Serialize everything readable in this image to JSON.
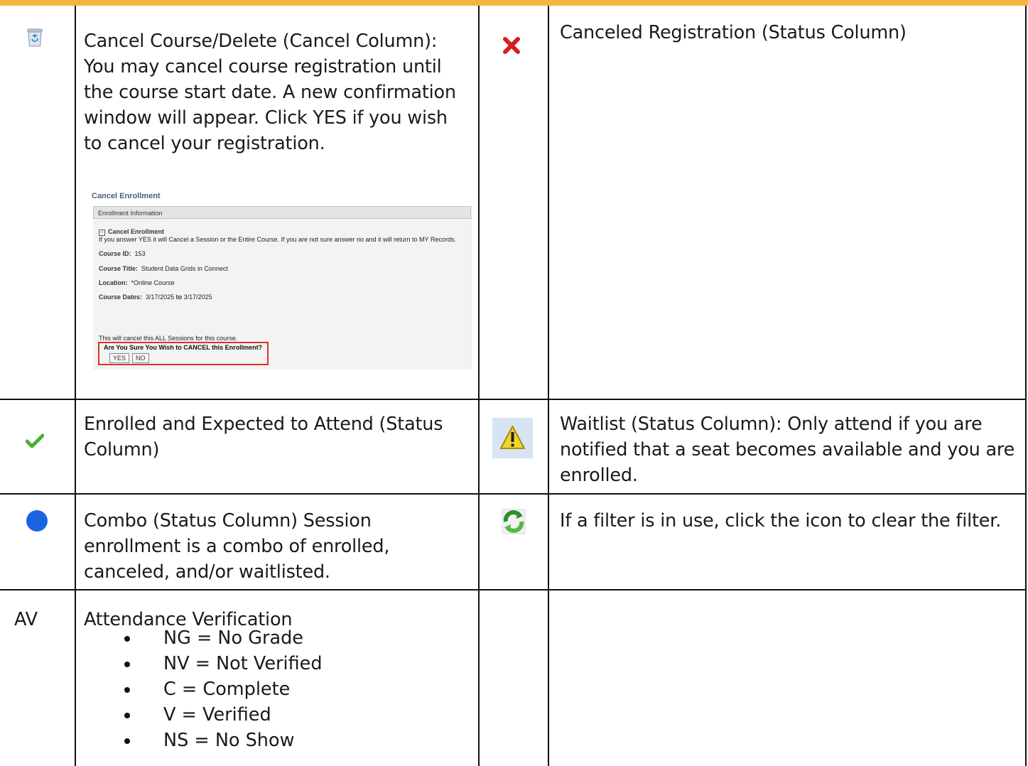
{
  "rows": [
    {
      "left_icon": "recycle-bin-icon",
      "left_text": "Cancel Course/Delete (Cancel Column): You may cancel course registration until the course start date.  A new confirmation window will appear.  Click YES if you wish to cancel your registration.",
      "right_icon": "red-x-icon",
      "right_text": "Canceled Registration (Status Column)"
    },
    {
      "left_icon": "green-checkmark-icon",
      "left_text": "Enrolled and Expected to Attend (Status Column)",
      "right_icon": "warning-icon",
      "right_text": "Waitlist (Status Column): Only attend if you are notified that a seat becomes available and you are enrolled."
    },
    {
      "left_icon": "blue-dot-icon",
      "left_text": "Combo (Status Column) Session enrollment is a combo of enrolled, canceled, and/or waitlisted.",
      "right_icon": "refresh-icon",
      "right_text": "If a filter is in use, click the icon to clear the filter."
    },
    {
      "left_code": "AV",
      "left_text": "Attendance Verification",
      "list": [
        "NG = No Grade",
        "NV = Not Verified",
        "C = Complete",
        "V = Verified",
        "NS = No Show"
      ]
    }
  ],
  "left_text_lines": {
    "row1": [
      "Cancel Course/Delete (Cancel Column):",
      "You may cancel course registration until",
      "the course start date.  A new confirmation",
      "window will appear.  Click YES if you wish",
      "to cancel your registration."
    ],
    "row2": [
      "Enrolled and Expected to Attend (Status",
      "Column)"
    ],
    "row3": [
      "Combo (Status Column) Session",
      "enrollment is a combo of enrolled,",
      "canceled, and/or waitlisted."
    ]
  },
  "right_text_lines": {
    "row2": [
      "Waitlist (Status Column): Only attend if you are",
      "notified that a seat becomes available and you are",
      "enrolled."
    ]
  },
  "cancel_dialog": {
    "title": "Cancel Enrollment",
    "panel_header": "Enrollment Information",
    "section_title": "Cancel Enrollment",
    "notice": "If you answer YES it will Cancel a Session or the Entire Course. If you are not sure answer no and it will return to MY Records.",
    "course_id_label": "Course ID:",
    "course_id": "153",
    "course_title_label": "Course Title:",
    "course_title": "Student Data Grids in Connect",
    "location_label": "Location:",
    "location": "*Online Course",
    "course_dates_label": "Course Dates:",
    "date_start": "3/17/2025",
    "date_to": "to",
    "date_end": "3/17/2025",
    "all_sessions_note": "This will cancel this ALL Sessions for this course.",
    "confirm_question": "Are You Sure You Wish to CANCEL this Enrollment?",
    "yes_label": "YES",
    "no_label": "NO"
  },
  "colors": {
    "top_bar": "#f2b640",
    "confirm_box": "#e0302a",
    "blue_dot": "#1a63e3",
    "check_green": "#4caf2f",
    "x_red": "#d21f1f"
  }
}
